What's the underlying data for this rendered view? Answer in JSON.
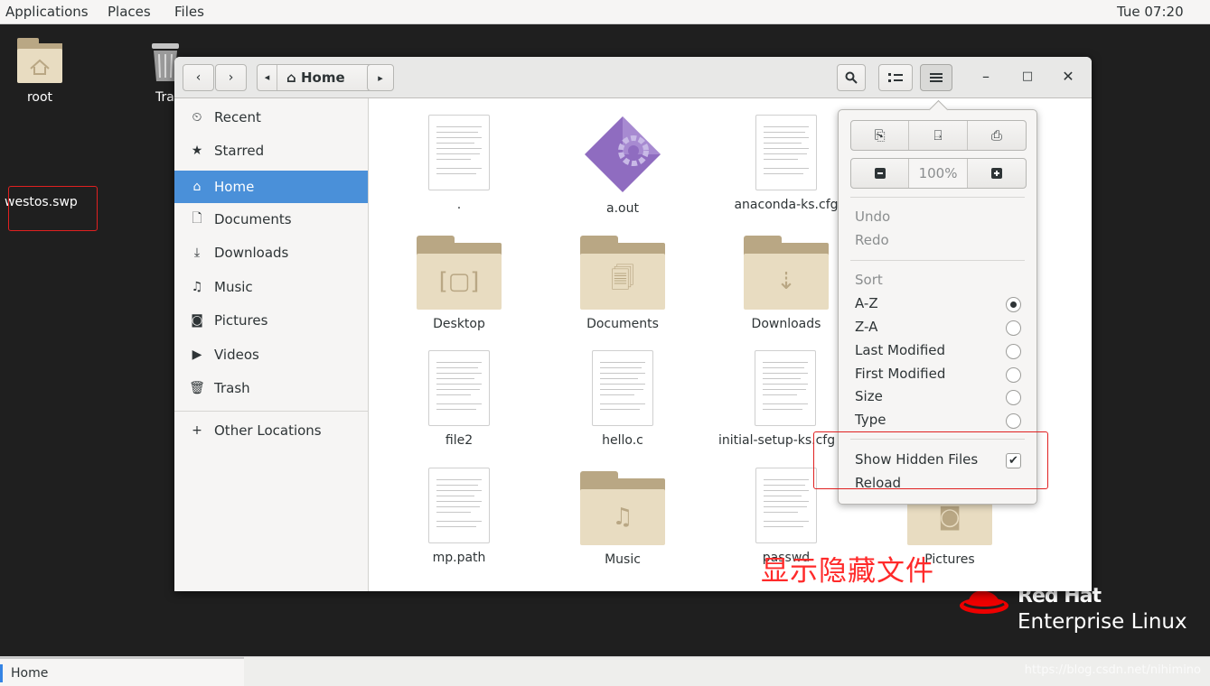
{
  "topbar": {
    "applications": "Applications",
    "places": "Places",
    "files": "Files",
    "clock": "Tue 07:20"
  },
  "desktop": {
    "icons": [
      {
        "label": "root"
      },
      {
        "label": "Tra"
      }
    ],
    "file_label": "westos.swp"
  },
  "window": {
    "back_icon": "‹",
    "forward_icon": "›",
    "path_left_icon": "◂",
    "path_label": "Home",
    "path_right_icon": "▸",
    "search_icon": "🔍",
    "view_icon": "≔",
    "menu_icon": "≡",
    "minimize": "–",
    "maximize": "□",
    "close": "✕"
  },
  "sidebar": {
    "items": [
      {
        "label": "Recent",
        "icon": "⏲"
      },
      {
        "label": "Starred",
        "icon": "★"
      },
      {
        "label": "Home",
        "icon": "⌂"
      },
      {
        "label": "Documents",
        "icon": "🗋"
      },
      {
        "label": "Downloads",
        "icon": "⤓"
      },
      {
        "label": "Music",
        "icon": "♫"
      },
      {
        "label": "Pictures",
        "icon": "◙"
      },
      {
        "label": "Videos",
        "icon": "▶"
      },
      {
        "label": "Trash",
        "icon": "🗑"
      },
      {
        "label": "Other Locations",
        "icon": "+"
      }
    ]
  },
  "files": [
    {
      "name": "."
    },
    {
      "name": "a.out"
    },
    {
      "name": "anaconda-ks.cfg"
    },
    {
      "name": "Desktop"
    },
    {
      "name": "Documents"
    },
    {
      "name": "Downloads"
    },
    {
      "name": "file2"
    },
    {
      "name": "hello.c"
    },
    {
      "name": "initial-setup-ks.cfg"
    },
    {
      "name": "mp.path"
    },
    {
      "name": "Music"
    },
    {
      "name": "passwd"
    },
    {
      "name": "Pictures"
    }
  ],
  "menu": {
    "zoom": "100%",
    "undo": "Undo",
    "redo": "Redo",
    "sort": "Sort",
    "sort_options": [
      {
        "label": "A-Z",
        "selected": true
      },
      {
        "label": "Z-A"
      },
      {
        "label": "Last Modified"
      },
      {
        "label": "First Modified"
      },
      {
        "label": "Size"
      },
      {
        "label": "Type"
      }
    ],
    "show_hidden": "Show Hidden Files",
    "show_hidden_checked": true,
    "reload": "Reload"
  },
  "annotation": "显示隐藏文件",
  "branding": {
    "line1": "Red Hat",
    "line2": "Enterprise Linux"
  },
  "taskbar": {
    "item": "Home"
  },
  "watermark": "https://blog.csdn.net/nihimino"
}
